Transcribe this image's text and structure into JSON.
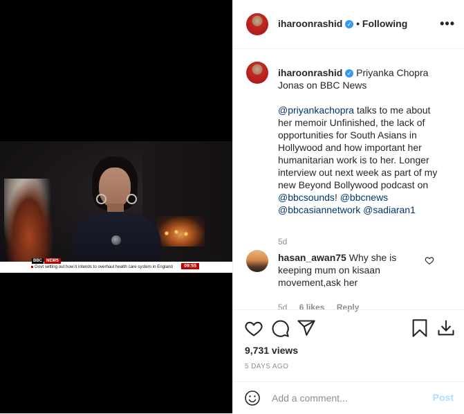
{
  "post": {
    "author": "iharoonrashid",
    "follow_status": "• Following",
    "caption_title": "Priyanka Chopra Jonas on BBC News",
    "caption_mention_1": "@priyankachopra",
    "caption_text_1": " talks to me about her memoir Unfinished, the lack of opportunities for South Asians in Hollywood and how important her humanitarian work is to her. Longer interview out next week as part of my new Beyond Bollywood podcast on ",
    "caption_mention_2": "@bbcsounds",
    "caption_text_2": "! ",
    "caption_mention_3": "@bbcnews",
    "caption_text_3": " ",
    "caption_mention_4": "@bbcasiannetwork",
    "caption_text_4": " ",
    "caption_mention_5": "@sadiaran1",
    "caption_age": "5d",
    "views": "9,731 views",
    "posted": "5 DAYS AGO"
  },
  "video": {
    "channel_left": "BBC",
    "channel_right": "NEWS",
    "ticker_text": "Govt setting out how it intends to overhaul health care system in England",
    "clock": "09:55"
  },
  "comment": {
    "author": "hasan_awan75",
    "text": "Why she is keeping mum on kisaan movement,ask her",
    "age": "5d",
    "likes": "6 likes",
    "reply": "Reply"
  },
  "composer": {
    "placeholder": "Add a comment...",
    "post_label": "Post"
  },
  "colors": {
    "link": "#00376b",
    "verified": "#3897f0",
    "muted": "#8e8e8e",
    "post_disabled": "#b3dbff",
    "bbc_red": "#b80000"
  }
}
